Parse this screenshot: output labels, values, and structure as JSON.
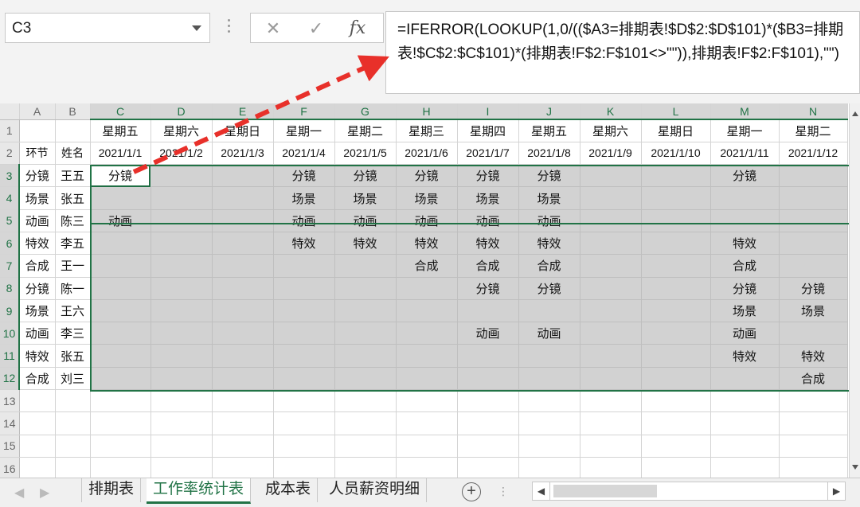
{
  "name_box": "C3",
  "formula_buttons": {
    "cancel": "✕",
    "enter": "✓",
    "fx": "fx"
  },
  "formula": "=IFERROR(LOOKUP(1,0/(($A3=排期表!$D$2:$D$101)*($B3=排期表!$C$2:$C$101)*(排期表!F$2:F$101<>\"\")),排期表!F$2:F$101),\"\")",
  "columns": [
    "A",
    "B",
    "C",
    "D",
    "E",
    "F",
    "G",
    "H",
    "I",
    "J",
    "K",
    "L",
    "M",
    "N"
  ],
  "active_column": "C",
  "rows": [
    [
      "",
      "",
      "星期五",
      "星期六",
      "星期日",
      "星期一",
      "星期二",
      "星期三",
      "星期四",
      "星期五",
      "星期六",
      "星期日",
      "星期一",
      "星期二"
    ],
    [
      "环节",
      "姓名",
      "2021/1/1",
      "2021/1/2",
      "2021/1/3",
      "2021/1/4",
      "2021/1/5",
      "2021/1/6",
      "2021/1/7",
      "2021/1/8",
      "2021/1/9",
      "2021/1/10",
      "2021/1/11",
      "2021/1/12"
    ],
    [
      "分镜",
      "王五",
      "分镜",
      "",
      "",
      "分镜",
      "分镜",
      "分镜",
      "分镜",
      "分镜",
      "",
      "",
      "分镜",
      ""
    ],
    [
      "场景",
      "张五",
      "",
      "",
      "",
      "场景",
      "场景",
      "场景",
      "场景",
      "场景",
      "",
      "",
      "",
      ""
    ],
    [
      "动画",
      "陈三",
      "动画",
      "",
      "",
      "动画",
      "动画",
      "动画",
      "动画",
      "动画",
      "",
      "",
      "",
      ""
    ],
    [
      "特效",
      "李五",
      "",
      "",
      "",
      "特效",
      "特效",
      "特效",
      "特效",
      "特效",
      "",
      "",
      "特效",
      ""
    ],
    [
      "合成",
      "王一",
      "",
      "",
      "",
      "",
      "",
      "合成",
      "合成",
      "合成",
      "",
      "",
      "合成",
      ""
    ],
    [
      "分镜",
      "陈一",
      "",
      "",
      "",
      "",
      "",
      "",
      "分镜",
      "分镜",
      "",
      "",
      "分镜",
      "分镜"
    ],
    [
      "场景",
      "王六",
      "",
      "",
      "",
      "",
      "",
      "",
      "",
      "",
      "",
      "",
      "场景",
      "场景"
    ],
    [
      "动画",
      "李三",
      "",
      "",
      "",
      "",
      "",
      "",
      "动画",
      "动画",
      "",
      "",
      "动画",
      ""
    ],
    [
      "特效",
      "张五",
      "",
      "",
      "",
      "",
      "",
      "",
      "",
      "",
      "",
      "",
      "特效",
      "特效"
    ],
    [
      "合成",
      "刘三",
      "",
      "",
      "",
      "",
      "",
      "",
      "",
      "",
      "",
      "",
      "",
      "合成"
    ],
    [
      "",
      "",
      "",
      "",
      "",
      "",
      "",
      "",
      "",
      "",
      "",
      "",
      "",
      ""
    ],
    [
      "",
      "",
      "",
      "",
      "",
      "",
      "",
      "",
      "",
      "",
      "",
      "",
      "",
      ""
    ],
    [
      "",
      "",
      "",
      "",
      "",
      "",
      "",
      "",
      "",
      "",
      "",
      "",
      "",
      ""
    ],
    [
      "",
      "",
      "",
      "",
      "",
      "",
      "",
      "",
      "",
      "",
      "",
      "",
      "",
      ""
    ]
  ],
  "row_numbers": [
    "1",
    "2",
    "3",
    "4",
    "5",
    "6",
    "7",
    "8",
    "9",
    "10",
    "11",
    "12",
    "13",
    "14",
    "15",
    "16"
  ],
  "sheet_tabs": {
    "schedule": "排期表",
    "workrate": "工作率统计表",
    "cost": "成本表",
    "salary": "人员薪资明细"
  },
  "tab_nav": {
    "prev": "◀",
    "next": "▶"
  },
  "add_sheet": "+",
  "tab_dots": "⋮",
  "hscroll": {
    "left": "◀",
    "right": "▶"
  },
  "colors": {
    "accent": "#217346",
    "arrow": "#e8302a",
    "shade": "#d2d2d2"
  }
}
